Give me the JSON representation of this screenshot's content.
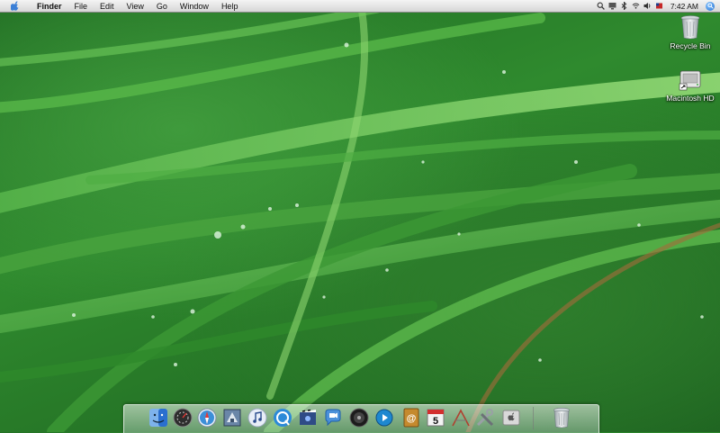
{
  "menubar": {
    "app_name": "Finder",
    "menus": [
      "File",
      "Edit",
      "View",
      "Go",
      "Window",
      "Help"
    ],
    "clock": "7:42 AM",
    "status_icons": [
      "magnifier-icon",
      "display-icon",
      "bluetooth-icon",
      "wifi-icon",
      "volume-icon",
      "flag-icon"
    ]
  },
  "desktop": {
    "icons": [
      {
        "label": "Recycle Bin",
        "icon": "trash-icon"
      },
      {
        "label": "Macintosh HD",
        "icon": "hard-drive-icon"
      }
    ]
  },
  "dock": {
    "items": [
      {
        "icon": "finder-icon",
        "color": "#3b7fd6"
      },
      {
        "icon": "dashboard-icon",
        "color": "#3a3a3a"
      },
      {
        "icon": "safari-icon",
        "color": "#3c8fd8"
      },
      {
        "icon": "mail-icon",
        "color": "#6a86a8"
      },
      {
        "icon": "itunes-icon",
        "color": "#c9d7ee"
      },
      {
        "icon": "ichat-icon",
        "color": "#2c8ad8"
      },
      {
        "icon": "imovie-icon",
        "color": "#2f4b86"
      },
      {
        "icon": "video-chat-icon",
        "color": "#4a90d9"
      },
      {
        "icon": "dvd-player-icon",
        "color": "#222"
      },
      {
        "icon": "quicktime-icon",
        "color": "#1e88d0"
      },
      {
        "icon": "address-book-icon",
        "color": "#c58a2e"
      },
      {
        "icon": "calendar-icon",
        "color": "#e8e8e8",
        "text": "5"
      },
      {
        "icon": "preview-icon",
        "color": "#b04030"
      },
      {
        "icon": "utilities-icon",
        "color": "#9aa0a6"
      },
      {
        "icon": "apple-icon",
        "color": "#d9d9d9"
      },
      {
        "icon": "trash-icon",
        "color": "#cfd6da"
      }
    ]
  }
}
